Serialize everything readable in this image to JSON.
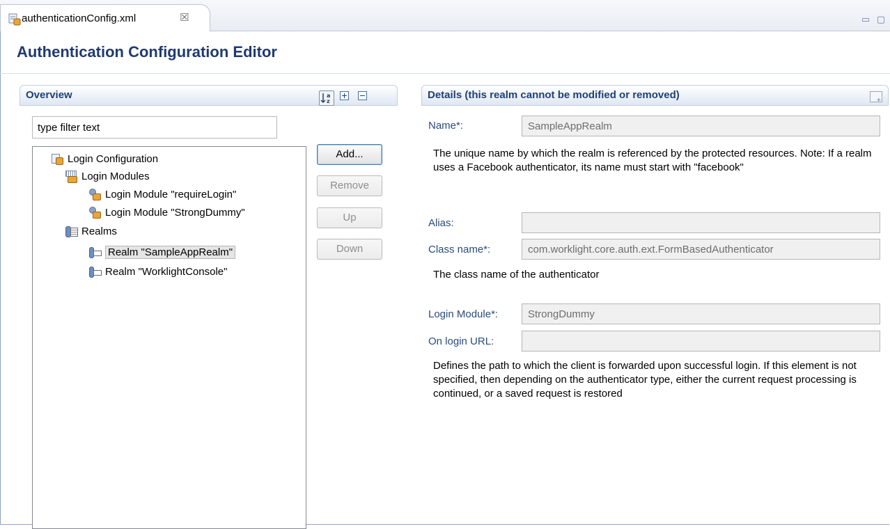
{
  "tab": {
    "title": "authenticationConfig.xml",
    "close_glyph": "☒",
    "icon": "xml-config-icon",
    "window_controls": "▭ ▢"
  },
  "editor": {
    "title": "Authentication Configuration Editor"
  },
  "overview": {
    "title": "Overview",
    "toolbar": [
      "sort-icon",
      "expand-all-icon",
      "collapse-all-icon"
    ],
    "filter_placeholder": "type filter text",
    "tree": [
      {
        "label": "Login Configuration",
        "icon": "config-icon",
        "level": 0
      },
      {
        "label": "Login Modules",
        "icon": "login-modules-icon",
        "level": 1
      },
      {
        "label": "Login Module \"requireLogin\"",
        "icon": "login-module-icon",
        "level": 2
      },
      {
        "label": "Login Module \"StrongDummy\"",
        "icon": "login-module-icon",
        "level": 2
      },
      {
        "label": "Realms",
        "icon": "realms-icon",
        "level": 1
      },
      {
        "label": "Realm \"SampleAppRealm\"",
        "icon": "realm-icon",
        "level": 2,
        "selected": true
      },
      {
        "label": "Realm \"WorklightConsole\"",
        "icon": "realm-icon",
        "level": 2
      }
    ],
    "buttons": {
      "add": "Add...",
      "remove": "Remove",
      "up": "Up",
      "down": "Down"
    }
  },
  "details": {
    "title": "Details (this realm cannot be modified or removed)",
    "name_label": "Name*:",
    "name_value": "SampleAppRealm",
    "name_desc": "The unique name by which the realm is referenced by the protected resources. Note: If a realm uses a Facebook authenticator, its name must start with \"facebook\"",
    "alias_label": "Alias:",
    "alias_value": "",
    "class_label": "Class name*:",
    "class_value": "com.worklight.core.auth.ext.FormBasedAuthenticator",
    "class_desc": "The class name of the authenticator",
    "login_module_label": "Login Module*:",
    "login_module_value": "StrongDummy",
    "login_url_label": "On login URL:",
    "login_url_value": "",
    "login_url_desc": "Defines the path to which the client is forwarded upon successful login. If this element is not specified, then depending on the authenticator type, either the current request processing is continued, or a saved request is restored"
  },
  "colors": {
    "title": "#203a70",
    "label": "#2a4b7c",
    "selection": "#e5e5e5"
  }
}
